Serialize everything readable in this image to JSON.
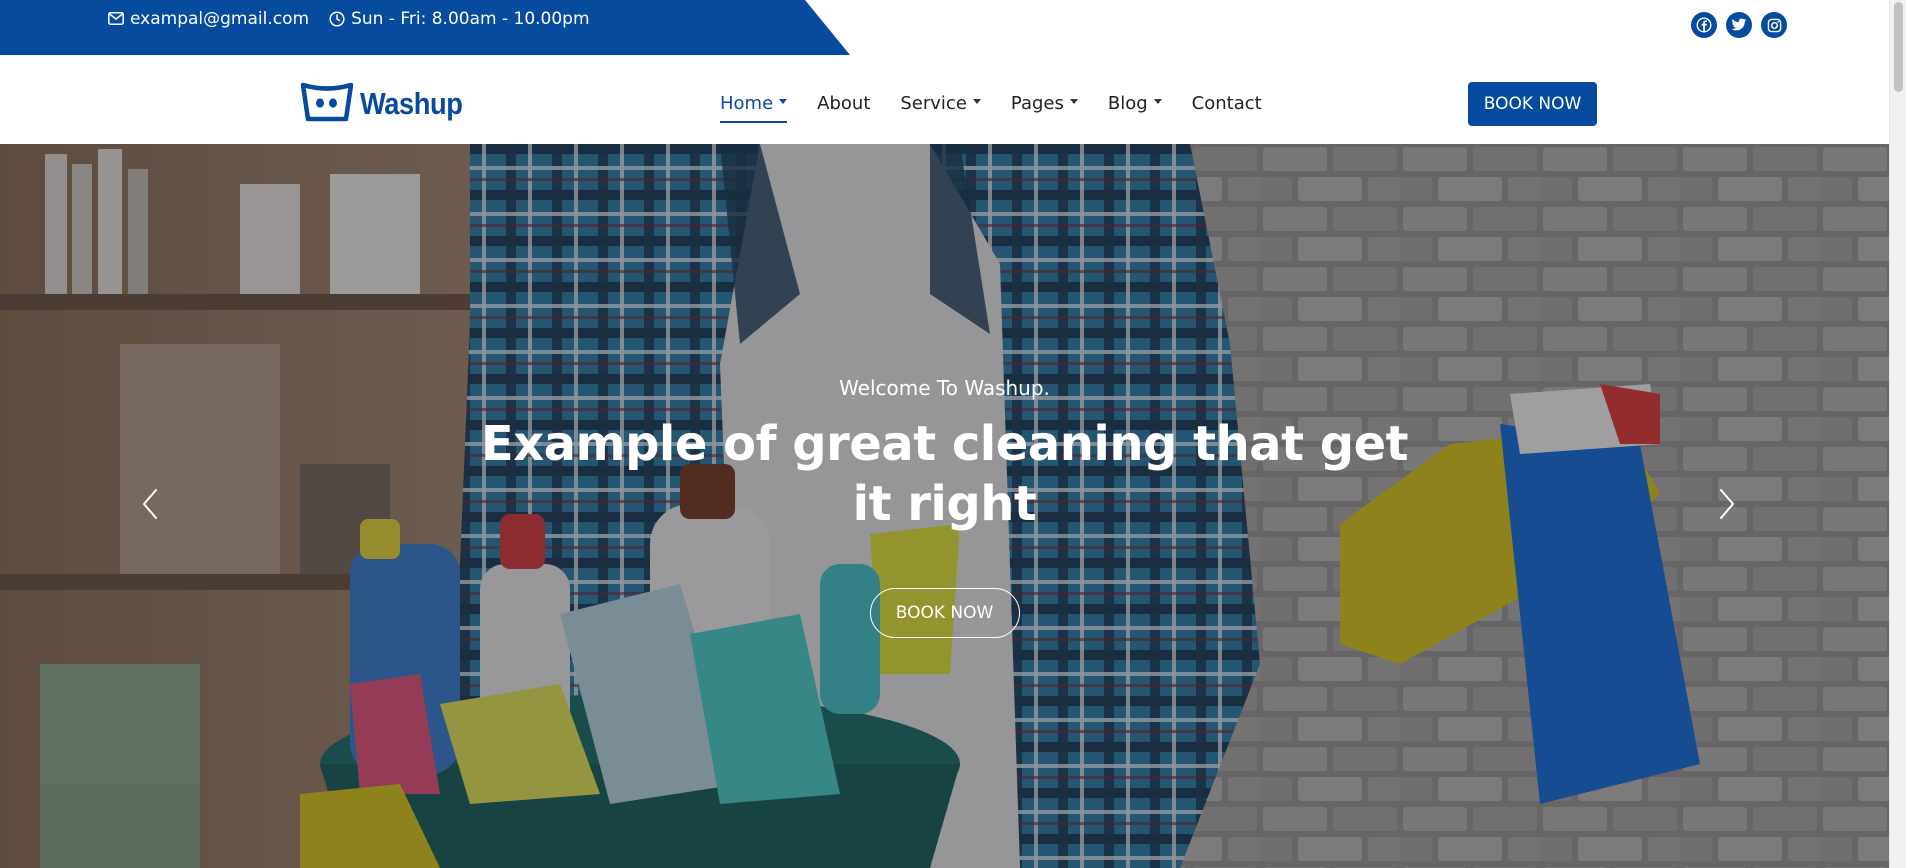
{
  "topbar": {
    "email": "exampal@gmail.com",
    "hours": "Sun - Fri: 8.00am - 10.00pm",
    "social": [
      "facebook-icon",
      "twitter-icon",
      "instagram-icon"
    ],
    "brand_color": "#064b9d"
  },
  "navbar": {
    "logo_text": "Washup",
    "items": [
      {
        "label": "Home",
        "dropdown": true,
        "active": true
      },
      {
        "label": "About",
        "dropdown": false,
        "active": false
      },
      {
        "label": "Service",
        "dropdown": true,
        "active": false
      },
      {
        "label": "Pages",
        "dropdown": true,
        "active": false
      },
      {
        "label": "Blog",
        "dropdown": true,
        "active": false
      },
      {
        "label": "Contact",
        "dropdown": false,
        "active": false
      }
    ],
    "book_label": "BOOK NOW"
  },
  "hero": {
    "subtitle": "Welcome To Washup.",
    "title": "Example of great cleaning that get it right",
    "button_label": "BOOK NOW",
    "prev_icon": "chevron-left-icon",
    "next_icon": "chevron-right-icon"
  }
}
